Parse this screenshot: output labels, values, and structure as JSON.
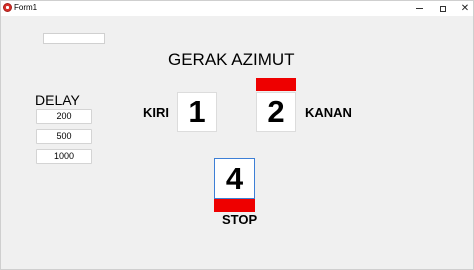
{
  "window": {
    "title": "Form1",
    "controls": {
      "minimize_icon": "minimize-icon",
      "maximize_icon": "maximize-icon",
      "close_icon": "close-icon",
      "close_glyph": "✕"
    }
  },
  "main": {
    "text_input_value": "",
    "heading": "GERAK AZIMUT",
    "delay": {
      "label": "DELAY",
      "buttons": [
        "200",
        "500",
        "1000"
      ]
    },
    "directions": {
      "left_label": "KIRI",
      "right_label": "KANAN",
      "stop_label": "STOP"
    },
    "keys": {
      "left": "1",
      "right": "2",
      "stop": "4"
    },
    "indicators": {
      "active_color": "#ee0000"
    }
  }
}
